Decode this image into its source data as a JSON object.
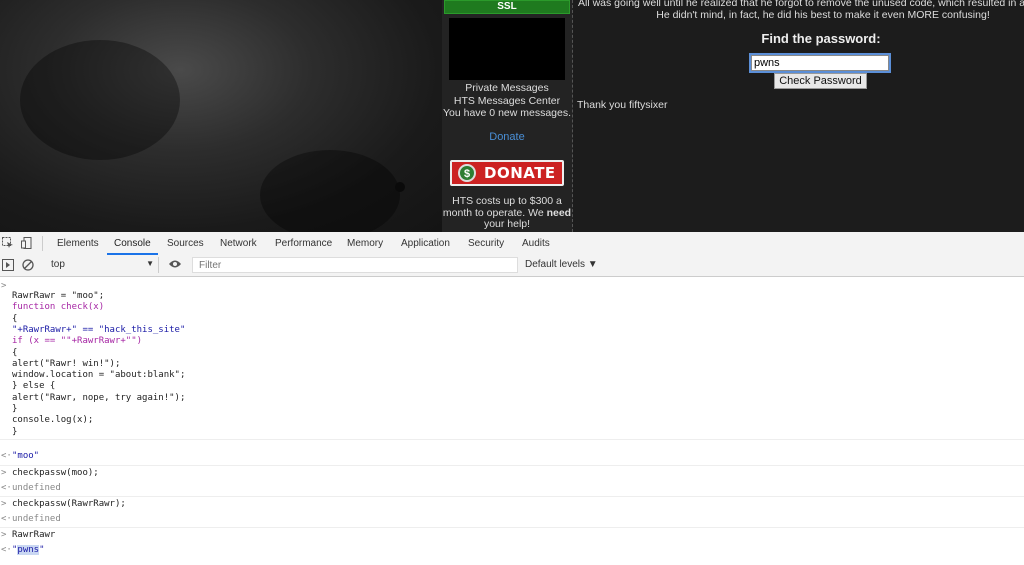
{
  "site": {
    "ssl_label": "SSL",
    "sidebar": {
      "private_messages": "Private Messages",
      "messages_center": "HTS Messages Center",
      "new_messages": "You have 0 new messages.",
      "donate_link": "Donate",
      "donate_button": "DONATE",
      "donate_coin": "$",
      "cost_line1": "HTS costs up to $300 a",
      "cost_line2_pre": "month to operate. We ",
      "cost_line2_bold": "need",
      "cost_line3": "your help!"
    },
    "content": {
      "intro_line1": "All was going well until he realized that he forgot to remove the unused code, which resulted in a confus",
      "intro_line2": "He didn't mind, in fact, he did his best to make it even MORE confusing!",
      "find_title": "Find the password:",
      "password_value": "pwns",
      "check_button": "Check Password",
      "thanks": "Thank you fiftysixer"
    }
  },
  "devtools": {
    "tabs": [
      "Elements",
      "Console",
      "Sources",
      "Network",
      "Performance",
      "Memory",
      "Application",
      "Security",
      "Audits"
    ],
    "active_tab": "Console",
    "context_value": "top",
    "filter_placeholder": "Filter",
    "levels_label": "Default levels ▼",
    "console": {
      "input_prompt": ">",
      "output_prompt": "<·",
      "script_lines": [
        "RawrRawr = \"moo\";",
        "function check(x)",
        "{",
        "\"+RawrRawr+\" == \"hack_this_site\"",
        "if (x == \"\"+RawrRawr+\"\")",
        "{",
        "alert(\"Rawr! win!\");",
        "window.location = \"about:blank\";",
        "} else {",
        "alert(\"Rawr, nope, try again!\");",
        "}",
        "console.log(x);",
        "}"
      ],
      "result1": "\"moo\"",
      "cmd2": "checkpassw(moo);",
      "result2": "undefined",
      "cmd3": "checkpassw(RawrRawr);",
      "result3": "undefined",
      "cmd4": "RawrRawr",
      "result4_quote_open": "\"",
      "result4_value": "pwns",
      "result4_quote_close": "\""
    }
  },
  "colors": {
    "ssl_green": "#1f7a1f",
    "donate_red": "#cc2222",
    "link_blue": "#4a8fd6",
    "devtools_active": "#1a73e8"
  }
}
